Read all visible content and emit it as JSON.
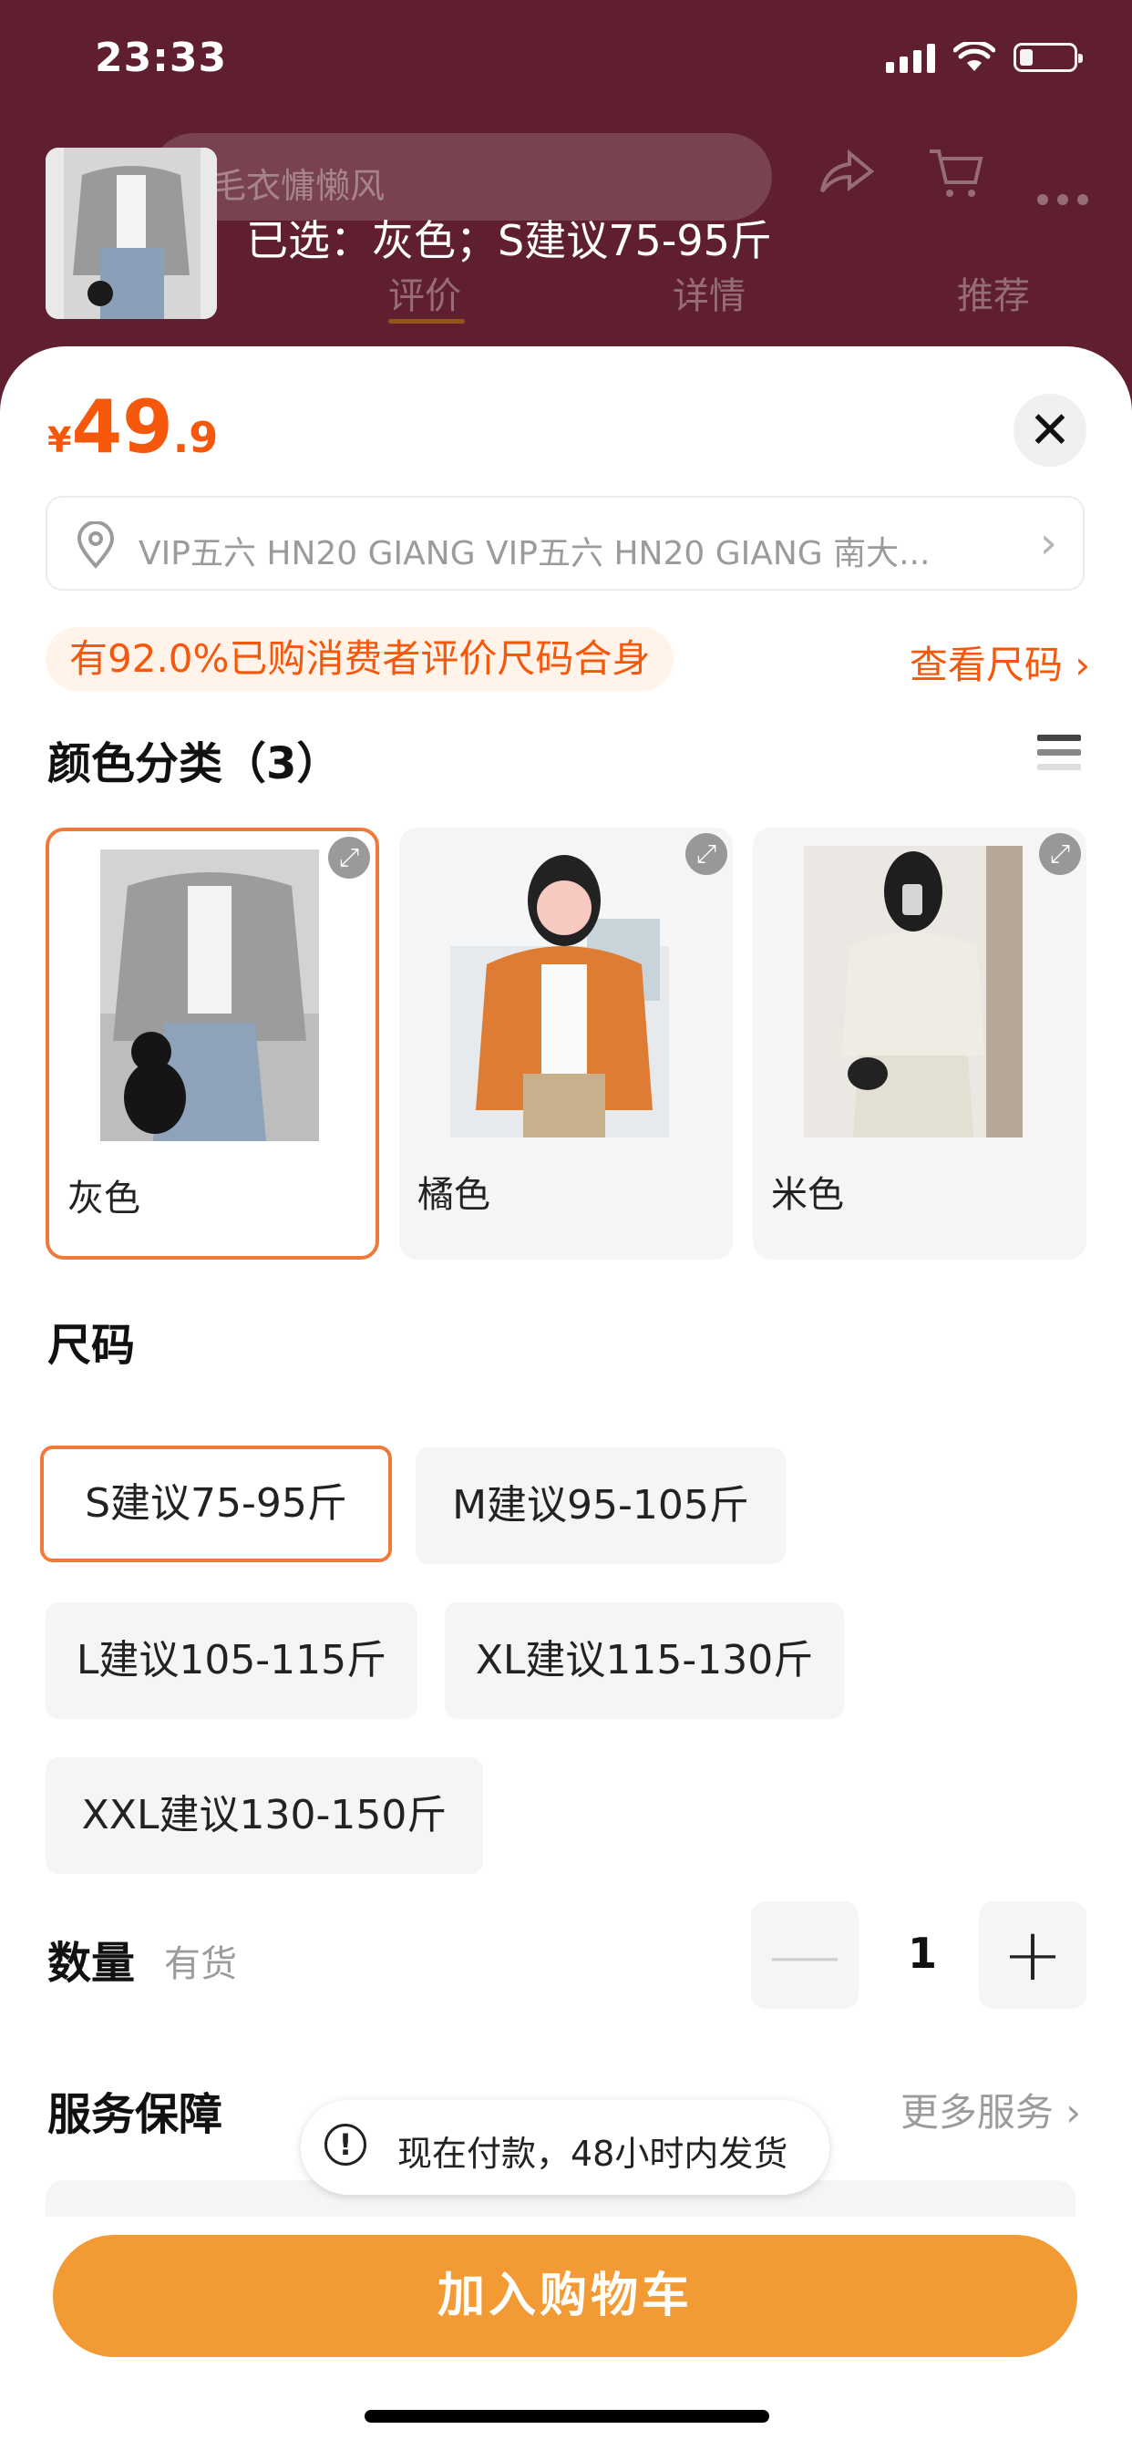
{
  "status_bar": {
    "time": "23:33"
  },
  "header": {
    "search_text": "毛衣慵懒风",
    "tabs": [
      "评价",
      "详情",
      "推荐"
    ],
    "selected_text": "已选：灰色；S建议75-95斤"
  },
  "sheet": {
    "price": {
      "currency": "¥",
      "integer": "49",
      "decimal": ".9"
    },
    "address": "VIP五六 HN20 GIANG VIP五六 HN20 GIANG 南大...",
    "fit_badge": "有92.0%已购消费者评价尺码合身",
    "size_link": "查看尺码",
    "color_section": {
      "title": "颜色分类（3）",
      "options": [
        {
          "label": "灰色",
          "selected": true
        },
        {
          "label": "橘色",
          "selected": false
        },
        {
          "label": "米色",
          "selected": false
        }
      ]
    },
    "size_section": {
      "title": "尺码",
      "options": [
        {
          "label": "S建议75-95斤",
          "selected": true
        },
        {
          "label": "M建议95-105斤",
          "selected": false
        },
        {
          "label": "L建议105-115斤",
          "selected": false
        },
        {
          "label": "XL建议115-130斤",
          "selected": false
        },
        {
          "label": "XXL建议130-150斤",
          "selected": false
        }
      ]
    },
    "quantity": {
      "label": "数量",
      "stock": "有货",
      "value": "1",
      "minus": "—",
      "plus": "+"
    },
    "service": {
      "title": "服务保障",
      "more": "更多服务"
    },
    "toast": "现在付款，48小时内发货",
    "add_to_cart": "加入购物车"
  },
  "colors": {
    "accent": "#f5570b",
    "button": "#f29a34",
    "header_bg": "#5f1f2e"
  }
}
